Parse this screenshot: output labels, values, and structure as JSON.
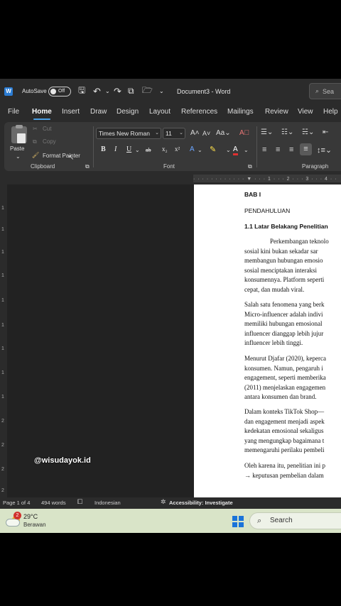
{
  "titlebar": {
    "autosave_label": "AutoSave",
    "autosave_state": "Off",
    "document_title": "Document3 - Word",
    "search_placeholder": "Sea"
  },
  "menu": {
    "tabs": [
      "File",
      "Home",
      "Insert",
      "Draw",
      "Design",
      "Layout",
      "References",
      "Mailings",
      "Review",
      "View",
      "Help"
    ],
    "active": "Home"
  },
  "ribbon": {
    "clipboard": {
      "paste": "Paste",
      "cut": "Cut",
      "copy": "Copy",
      "format_painter": "Format Painter",
      "group_label": "Clipboard"
    },
    "font": {
      "font_name": "Times New Roman",
      "font_size": "11",
      "group_label": "Font"
    },
    "paragraph": {
      "group_label": "Paragraph"
    }
  },
  "document": {
    "heading": "BAB I",
    "subheading": "PENDAHULUAN",
    "section": "1.1 Latar Belakang Penelitian",
    "lines": [
      "Perkembangan teknolo",
      "sosial kini bukan sekadar sar",
      "membangun hubungan emosio",
      "sosial menciptakan interaksi",
      "konsumennya. Platform seperti",
      "cepat, dan mudah viral.",
      "Salah satu fenomena yang berk",
      "Micro-influencer adalah indivi",
      "memiliki hubungan emosional",
      "influencer dianggap lebih jujur",
      "influencer lebih tinggi.",
      "Menurut Djafar (2020), keperca",
      "konsumen. Namun, pengaruh i",
      "engagement, seperti memberika",
      "(2011) menjelaskan engagemen",
      "antara konsumen dan brand.",
      "Dalam konteks TikTok Shop—",
      "dan engagement menjadi aspek",
      "kedekatan emosional sekaligus",
      "yang mengungkap bagaimana t",
      "memengaruhi perilaku pembeli",
      "Oleh karena itu, penelitian ini p",
      "→ keputusan pembelian dalam"
    ]
  },
  "watermark": "@wisudayok.id",
  "statusbar": {
    "page": "Page 1 of 4",
    "words": "494 words",
    "language": "Indonesian",
    "accessibility": "Accessibility: Investigate"
  },
  "taskbar": {
    "notification_count": "2",
    "temperature": "29°C",
    "condition": "Berawan",
    "search": "Search"
  },
  "colors": {
    "accent": "#4aa0e6",
    "word_blue": "#2b7cd3",
    "taskbar_bg": "#d9e4c8"
  }
}
